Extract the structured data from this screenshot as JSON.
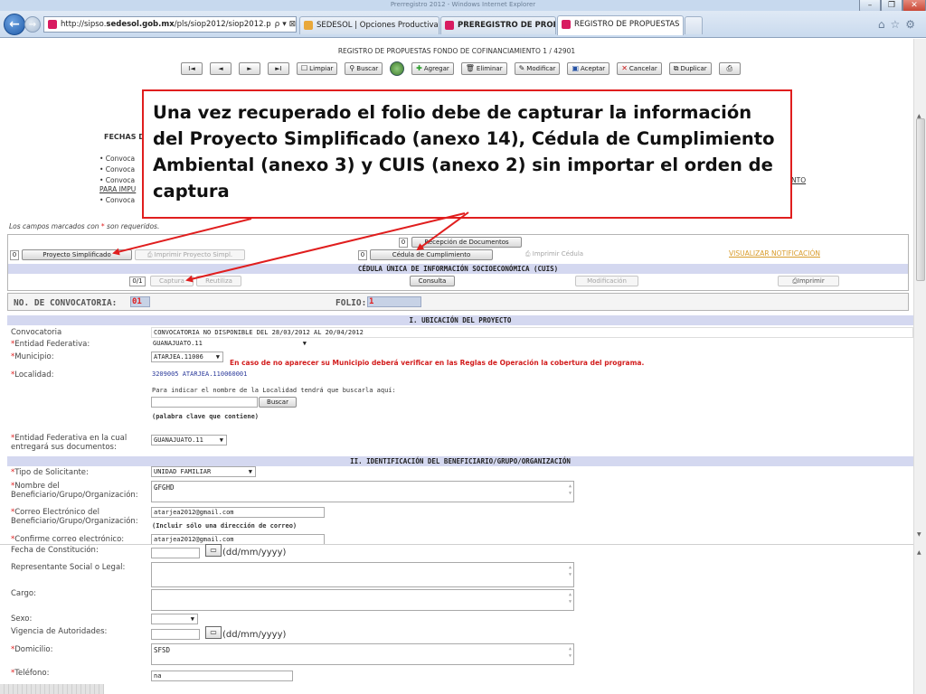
{
  "browser": {
    "window_title": "Prerregistro 2012 - Windows Internet Explorer",
    "address": {
      "prefix": "http://sipso.",
      "domain": "sedesol.gob.mx",
      "suffix": "/pls/siop2012/siop2012.p",
      "controls": "ρ ▾ ⊠ ↻ ✕"
    },
    "tabs": [
      {
        "label": "SEDESOL | Opciones Productivas",
        "icon_color": "#e9a83a"
      },
      {
        "label": "PREREGISTRO DE PROPUESTA...",
        "icon_color": "#d81b60"
      },
      {
        "label": "REGISTRO DE PROPUESTAS ...",
        "icon_color": "#d81b60",
        "close": "×"
      }
    ],
    "right_icons": "⌂☆⚙"
  },
  "page": {
    "header": "REGISTRO DE PROPUESTAS FONDO DE COFINANCIAMIENTO 1 / 42901",
    "toolbar": {
      "first": "I◄",
      "prev": "◄",
      "next": "►",
      "last": "►I",
      "limpiar": "Limpiar",
      "buscar": "Buscar",
      "agregar": "Agregar",
      "eliminar": "Eliminar",
      "modificar": "Modificar",
      "aceptar": "Aceptar",
      "cancelar": "Cancelar",
      "duplicar": "Duplicar"
    },
    "fechas_label": "FECHAS D",
    "bullets": [
      "• Convoca",
      "• Convoca",
      "• Convoca",
      "• Convoca"
    ],
    "para_impu": "PARA IMPU",
    "nto_link": "NTO",
    "callout": "Una vez recuperado el folio debe de capturar la información del Proyecto Simplificado (anexo 14), Cédula de Cumplimiento Ambiental (anexo 3) y CUIS (anexo 2) sin importar el orden de captura",
    "required_note": {
      "pre": "Los campos marcados con ",
      "star": "*",
      "post": " son requeridos."
    },
    "panel": {
      "count_recepcion": "0",
      "recepcion": "Recepción de Documentos",
      "count_proyecto": "0",
      "proyecto": "Proyecto Simplificado",
      "imprimir_proyecto": "Imprimir Proyecto Simpl.",
      "count_cedula": "0",
      "cedula": "Cédula de Cumplimiento",
      "imprimir_cedula": "Imprimir Cédula",
      "visualizar": "VISUALIZAR NOTIFICACIÓN",
      "cuis_title": "CÉDULA ÚNICA DE INFORMACIÓN SOCIOECONÓMICA (CUIS)",
      "cuis_count": "0/1",
      "captura": "Captura",
      "reutiliza": "Reutiliza",
      "consulta": "Consulta",
      "modificacion": "Modificación",
      "imprimir": "Imprimir"
    },
    "form": {
      "convocatoria_label": "NO. DE CONVOCATORIA:",
      "convocatoria_value": "01",
      "folio_label": "FOLIO:",
      "folio_value": "1",
      "section1": "I. UBICACIÓN DEL PROYECTO",
      "convocatoria_field_label": "Convocatoria",
      "convocatoria_field_value": "CONVOCATORIA NO DISPONIBLE DEL 28/03/2012 AL 20/04/2012",
      "entidad_label": "Entidad Federativa:",
      "entidad_value": "GUANAJUATO.11",
      "municipio_label": "Municipio:",
      "municipio_value": "ATARJEA.11006",
      "municipio_warning": "En caso de no aparecer su Municipio deberá verificar en las Reglas de Operación la cobertura del programa.",
      "localidad_label": "Localidad:",
      "localidad_value": "3209005 ATARJEA.110060001",
      "localidad_hint": "Para indicar el nombre de la Localidad tendrá que buscarla aquí:",
      "buscar": "Buscar",
      "palabra_clave": "(palabra clave que contiene)",
      "entidad_docs_label_1": "Entidad Federativa en la cual",
      "entidad_docs_label_2": "entregará sus documentos:",
      "entidad_docs_value": "GUANAJUATO.11",
      "section2": "II. IDENTIFICACIÓN DEL BENEFICIARIO/GRUPO/ORGANIZACIÓN",
      "tipo_label": "Tipo de Solicitante:",
      "tipo_value": "UNIDAD FAMILIAR",
      "nombre_label_1": "Nombre del",
      "nombre_label_2": "Beneficiario/Grupo/Organización:",
      "nombre_value": "GFGHD",
      "correo_label_1": "Correo Electrónico del",
      "correo_label_2": "Beneficiario/Grupo/Organización:",
      "correo_value": "atarjea2012@gmail.com",
      "correo_note": "(Incluir sólo una dirección de correo)",
      "confirme_label": "Confirme correo electrónico:",
      "confirme_value": "atarjea2012@gmail.com",
      "fecha_label": "Fecha de Constitución:",
      "date_format": "(dd/mm/yyyy)",
      "representante_label": "Representante Social o Legal:",
      "cargo_label": "Cargo:",
      "sexo_label": "Sexo:",
      "vigencia_label": "Vigencia de Autoridades:",
      "domicilio_label": "Domicilio:",
      "domicilio_value": "SFSD",
      "telefono_label": "Teléfono:",
      "telefono_value": "na"
    }
  },
  "colors": {
    "accent_red": "#e01e1e",
    "section_bar": "#d4d8f0",
    "link_orange": "#d89b2a"
  }
}
